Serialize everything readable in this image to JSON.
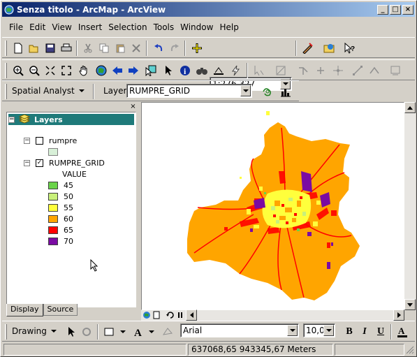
{
  "window": {
    "title": "Senza titolo - ArcMap - ArcView"
  },
  "menu": [
    "File",
    "Edit",
    "View",
    "Insert",
    "Selection",
    "Tools",
    "Window",
    "Help"
  ],
  "standard_toolbar": {
    "scale_value": "1:276.327"
  },
  "spatial_analyst_toolbar": {
    "label": "Spatial Analyst",
    "layer_label": "Layer:",
    "layer_value": "RUMPRE_GRID"
  },
  "toc": {
    "root_label": "Layers",
    "layer1": {
      "name": "rumpre",
      "checked": false
    },
    "layer2": {
      "name": "RUMPRE_GRID",
      "checked": true,
      "field_label": "VALUE"
    },
    "legend": [
      {
        "label": "45",
        "color": "#6ad34a"
      },
      {
        "label": "50",
        "color": "#c8f07a"
      },
      {
        "label": "55",
        "color": "#ffff3c"
      },
      {
        "label": "60",
        "color": "#ffa500"
      },
      {
        "label": "65",
        "color": "#ff0000"
      },
      {
        "label": "70",
        "color": "#7a0ba3"
      }
    ],
    "tabs": {
      "display": "Display",
      "source": "Source"
    }
  },
  "drawing_toolbar": {
    "label": "Drawing",
    "font": "Arial",
    "font_size": "10,00",
    "bold": "B",
    "italic": "I",
    "underline": "U"
  },
  "status": {
    "coordinates": "637068,65  943345,67 Meters"
  }
}
